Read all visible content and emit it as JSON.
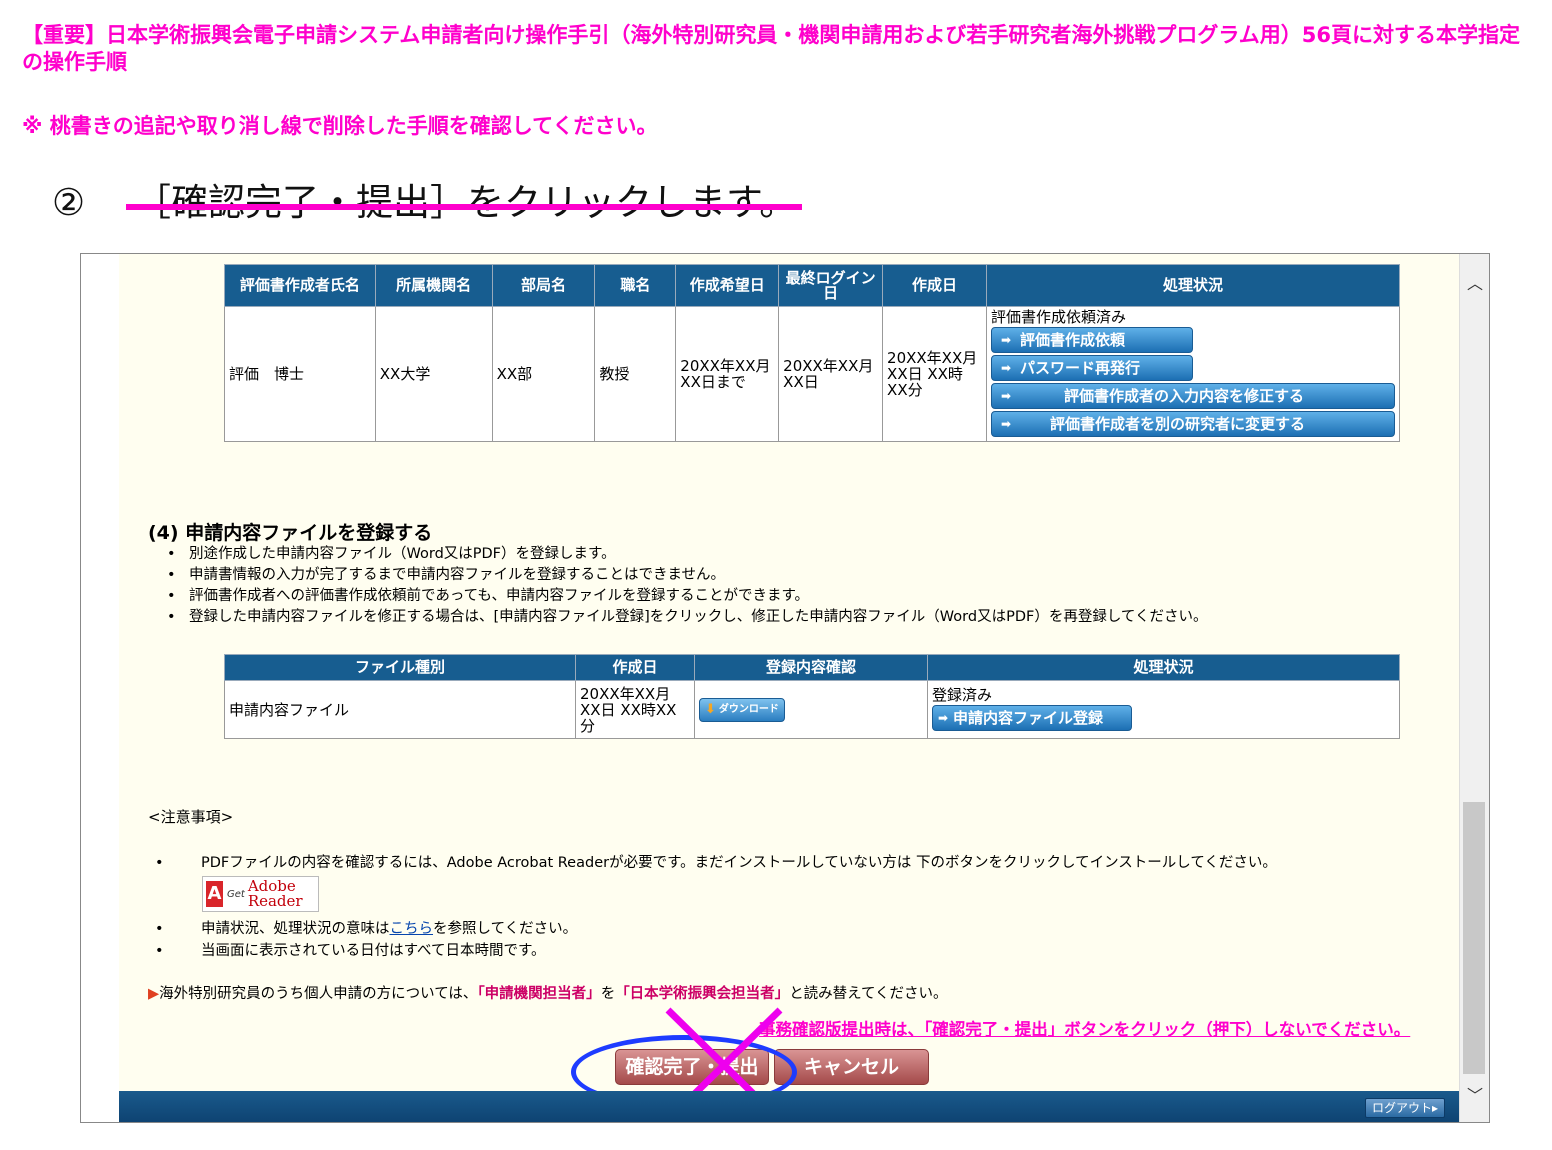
{
  "notice": {
    "line1": "【重要】日本学術振興会電子申請システム申請者向け操作手引（海外特別研究員・機関申請用および若手研究者海外挑戦プログラム用）56頁に対する本学指定の操作手順",
    "line2": "※ 桃書きの追記や取り消し線で削除した手順を確認してください。"
  },
  "step": {
    "number": "②",
    "text": "［確認完了・提出］をクリックします。"
  },
  "eval_table": {
    "headers": [
      "評価書作成者氏名",
      "所属機関名",
      "部局名",
      "職名",
      "作成希望日",
      "最終ログイン日",
      "作成日",
      "処理状況"
    ],
    "row": {
      "name": "評価　博士",
      "institution": "XX大学",
      "department": "XX部",
      "position": "教授",
      "desired_date": "20XX年XX月XX日まで",
      "last_login": "20XX年XX月XX日",
      "created": "20XX年XX月XX日 XX時XX分",
      "status": "評価書作成依頼済み"
    },
    "buttons": [
      "評価書作成依頼",
      "パスワード再発行",
      "評価書作成者の入力内容を修正する",
      "評価書作成者を別の研究者に変更する"
    ]
  },
  "section4": {
    "title": "(4) 申請内容ファイルを登録する",
    "bullets": [
      "別途作成した申請内容ファイル（Word又はPDF）を登録します。",
      "申請書情報の入力が完了するまで申請内容ファイルを登録することはできません。",
      "評価書作成者への評価書作成依頼前であっても、申請内容ファイルを登録することができます。",
      "登録した申請内容ファイルを修正する場合は、[申請内容ファイル登録]をクリックし、修正した申請内容ファイル（Word又はPDF）を再登録してください。"
    ]
  },
  "file_table": {
    "headers": [
      "ファイル種別",
      "作成日",
      "登録内容確認",
      "処理状況"
    ],
    "row": {
      "type": "申請内容ファイル",
      "created": "20XX年XX月XX日 XX時XX分",
      "download_label": "ダウンロード",
      "status": "登録済み",
      "register_button": "申請内容ファイル登録"
    }
  },
  "notes": {
    "title": "<注意事項>",
    "item1": "PDFファイルの内容を確認するには、Adobe Acrobat Readerが必要です。まだインストールしていない方は 下のボタンをクリックしてインストールしてください。",
    "adobe_get": "Get",
    "adobe_reader": "Adobe Reader",
    "adobe_logo": "A",
    "item2_pre": "申請状況、処理状況の意味は",
    "item2_link": "こちら",
    "item2_post": "を参照してください。",
    "item3": "当画面に表示されている日付はすべて日本時間です。"
  },
  "jsps_note": {
    "pre": "海外特別研究員のうち個人申請の方については、",
    "hl1": "「申請機関担当者」",
    "mid": "を",
    "hl2": "「日本学術振興会担当者」",
    "post": "と読み替えてください。"
  },
  "warning": "事務確認版提出時は、「確認完了・提出」ボタンをクリック（押下）しないでください。",
  "buttons": {
    "submit": "確認完了・提出",
    "cancel": "キャンセル",
    "logout": "ログアウト▸"
  },
  "colors": {
    "annotation_pink": "#ff00cc",
    "header_blue": "#175d90",
    "circle_blue": "#1e3cff"
  }
}
